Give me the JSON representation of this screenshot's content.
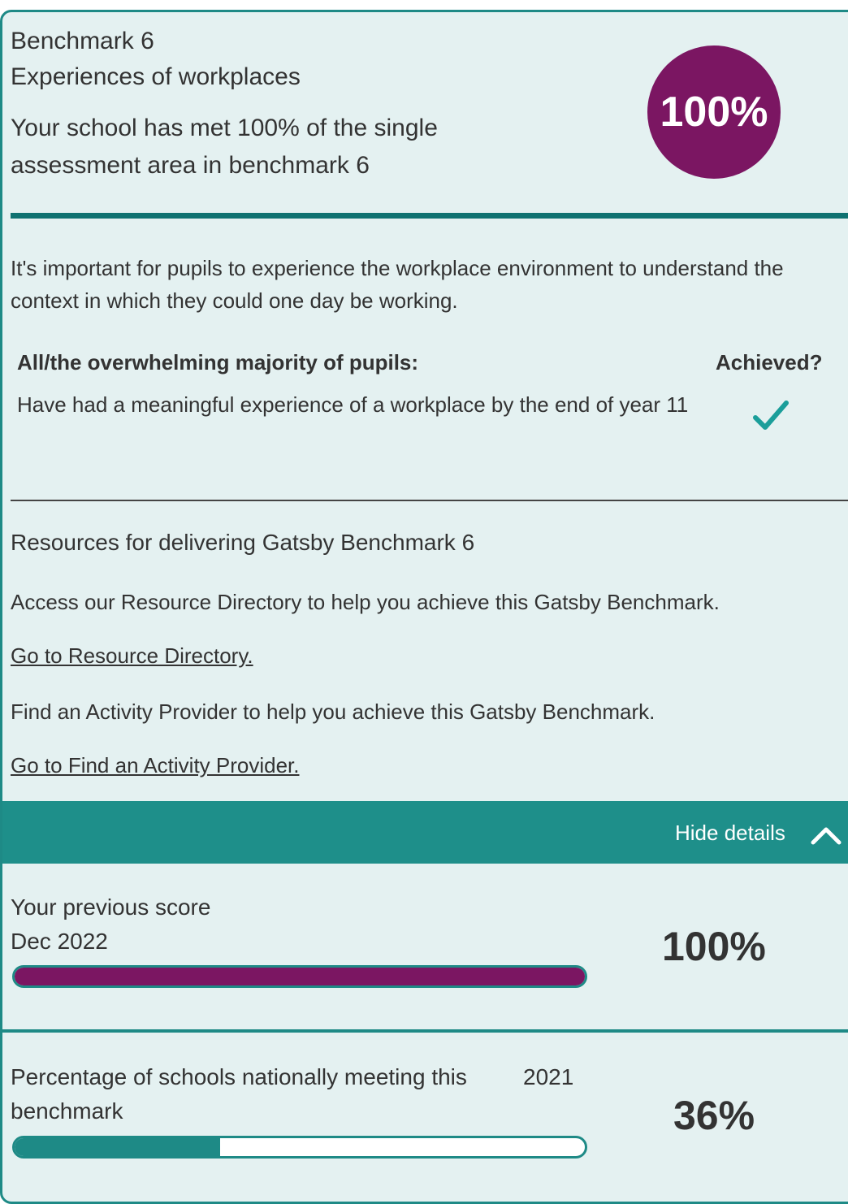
{
  "header": {
    "title": "Benchmark 6",
    "subtitle": "Experiences of workplaces",
    "description": "Your school has met 100% of the single assessment area in benchmark 6",
    "score_badge": "100%"
  },
  "intro": "It's important for pupils to experience the workplace environment to understand the context in which they could one day be working.",
  "criteria_table": {
    "header_left": "All/the overwhelming majority of pupils:",
    "header_right": "Achieved?",
    "rows": [
      {
        "text": "Have had a meaningful experience of a workplace by the end of year 11",
        "achieved_icon": "checkmark-icon"
      }
    ]
  },
  "resources": {
    "title": "Resources for delivering Gatsby Benchmark 6",
    "p1": "Access our Resource Directory to help you achieve this Gatsby Benchmark.",
    "link1": "Go to Resource Directory.",
    "p2": "Find an Activity Provider to help you achieve this Gatsby Benchmark.",
    "link2": "Go to Find an Activity Provider."
  },
  "details_toggle": {
    "label": "Hide details",
    "icon": "chevron-up-icon"
  },
  "previous_score": {
    "title": "Your previous score",
    "date": "Dec 2022",
    "score": "100%",
    "progress": 1.0
  },
  "national": {
    "title": "Percentage of schools nationally meeting this benchmark",
    "year": "2021",
    "score": "36%",
    "progress": 0.36
  },
  "colors": {
    "accent": "#1e8a86",
    "badge": "#7b1662",
    "card_bg": "#e4f1f1",
    "toggle_bar": "#1e8f8a",
    "national_fill": "#1e8a86",
    "previous_fill": "#7b1662"
  }
}
